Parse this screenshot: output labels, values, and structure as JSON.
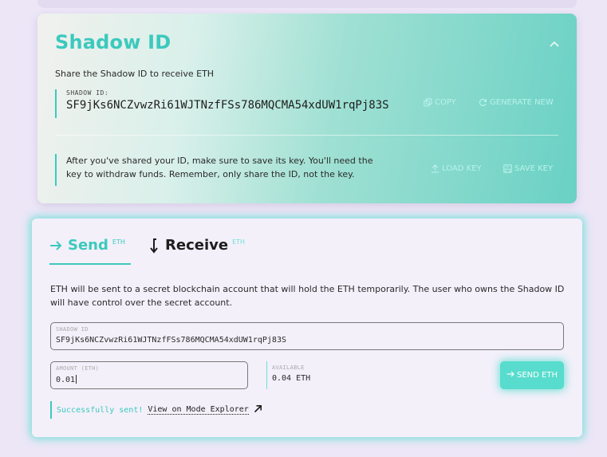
{
  "shadow_card": {
    "title": "Shadow ID",
    "subtitle": "Share the Shadow ID to receive ETH",
    "id_label": "SHADOW ID:",
    "id_value": "SF9jKs6NCZvwzRi61WJTNzfFSs786MQCMA54xdUW1rqPj83S",
    "copy_label": "COPY",
    "generate_label": "GENERATE NEW",
    "key_note": "After you've shared your ID, make sure to save its key. You'll need the key to withdraw funds. Remember, only share the ID, not the key.",
    "load_key_label": "LOAD KEY",
    "save_key_label": "SAVE KEY"
  },
  "transfer_card": {
    "tabs": [
      {
        "label": "Send",
        "unit": "ETH",
        "icon": "arrow-right-icon",
        "active": true
      },
      {
        "label": "Receive",
        "unit": "ETH",
        "icon": "arrow-down-icon",
        "active": false
      }
    ],
    "description": "ETH will be sent to a secret blockchain account that will hold the ETH temporarily. The user who owns the Shadow ID will have control over the secret account.",
    "shadow_field": {
      "label": "SHADOW ID",
      "value": "SF9jKs6NCZvwzRi61WJTNzfFSs786MQCMA54xdUW1rqPj83S"
    },
    "amount_field": {
      "label": "AMOUNT (ETH)",
      "value": "0.01"
    },
    "available": {
      "label": "AVAILABLE",
      "value": "0.04 ETH"
    },
    "send_button": "SEND ETH",
    "status_text": "Successfully sent!",
    "explorer_link": "View on Mode Explorer"
  },
  "colors": {
    "accent": "#3cc9bd",
    "button": "#57dccd",
    "background": "#ece6f7"
  }
}
